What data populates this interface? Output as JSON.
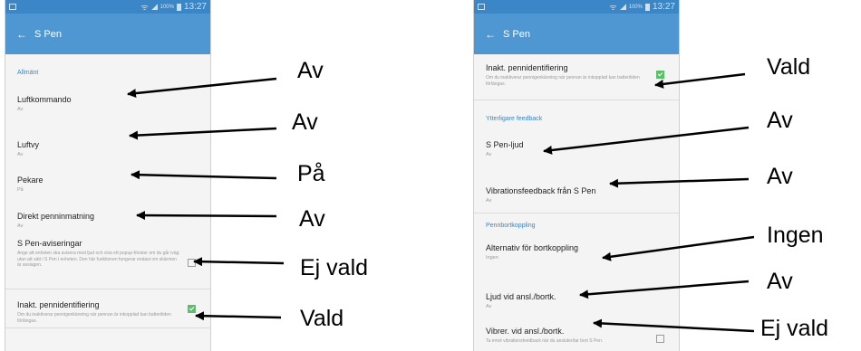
{
  "left_screen": {
    "status": {
      "percent": "100%",
      "time": "13:27"
    },
    "appbar": {
      "back_icon": "arrow-left-icon",
      "title": "S Pen"
    },
    "section_general": "Allmänt",
    "items": {
      "air_command": {
        "label": "Luftkommando",
        "value": "Av"
      },
      "air_view": {
        "label": "Luftvy",
        "value": "Av"
      },
      "pointer": {
        "label": "Pekare",
        "value": "På"
      },
      "direct_pen_input": {
        "label": "Direkt penninmatning",
        "value": "Av"
      },
      "pen_notifications": {
        "label": "S Pen-aviseringar",
        "desc": "Ange att enheten ska avisera med ljud och visa ett popup-fönster om du går iväg utan att sätt i S Pen i enheten. Den här funktionen fungerar endast om skärmen är avslagen.",
        "checked": false
      },
      "inactive_pen_detection": {
        "label": "Inakt. pennidentifiering",
        "desc": "Om du inaktiverar pennigenkänning när pennan är inkopplad kan batteritiden förlängas.",
        "checked": true
      }
    }
  },
  "right_screen": {
    "status": {
      "percent": "100%",
      "time": "13:27"
    },
    "appbar": {
      "back_icon": "arrow-left-icon",
      "title": "S Pen"
    },
    "items": {
      "inactive_pen_detection": {
        "label": "Inakt. pennidentifiering",
        "desc": "Om du inaktiverar pennigenkänning när pennan är inkopplad kan batteritiden förlängas.",
        "checked": true
      },
      "section_feedback": "Ytterligare feedback",
      "pen_sound": {
        "label": "S Pen-ljud",
        "value": "Av"
      },
      "vibration_feedback": {
        "label": "Vibrationsfeedback från S Pen",
        "value": "Av"
      },
      "section_detachment": "Pennbortkoppling",
      "detach_options": {
        "label": "Alternativ för bortkoppling",
        "value": "Ingen"
      },
      "sound_on_detach": {
        "label": "Ljud vid ansl./bortk.",
        "value": "Av"
      },
      "vibrate_on_detach": {
        "label": "Vibrer. vid ansl./bortk.",
        "desc": "Ta emot vibrationsfeedback när du ansluter/tar bort S Pen.",
        "checked": false
      }
    }
  },
  "annotations": {
    "left": [
      "Av",
      "Av",
      "På",
      "Av",
      "Ej vald",
      "Vald"
    ],
    "right": [
      "Vald",
      "Av",
      "Av",
      "Ingen",
      "Av",
      "Ej vald"
    ]
  },
  "colors": {
    "status_bar": "#3b86c7",
    "app_bar": "#4f97d2",
    "section_header": "#3c86c3",
    "checkbox_on": "#58c168"
  }
}
